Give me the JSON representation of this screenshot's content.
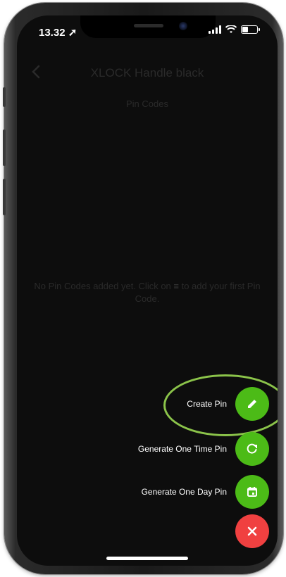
{
  "status_bar": {
    "time": "13.32 ➚"
  },
  "header": {
    "title": "XLOCK Handle black",
    "subtitle": "Pin Codes",
    "back_label": "<"
  },
  "empty_state": {
    "text_before": "No Pin Codes added yet. Click on ",
    "menu_glyph": "≡",
    "text_after": " to add your first Pin Code."
  },
  "fab_menu": {
    "create_pin": "Create Pin",
    "one_time_pin": "Generate One Time Pin",
    "one_day_pin": "Generate One Day Pin",
    "colors": {
      "green": "#4cbb17",
      "red": "#f04040",
      "highlight": "#8bc34a"
    }
  }
}
